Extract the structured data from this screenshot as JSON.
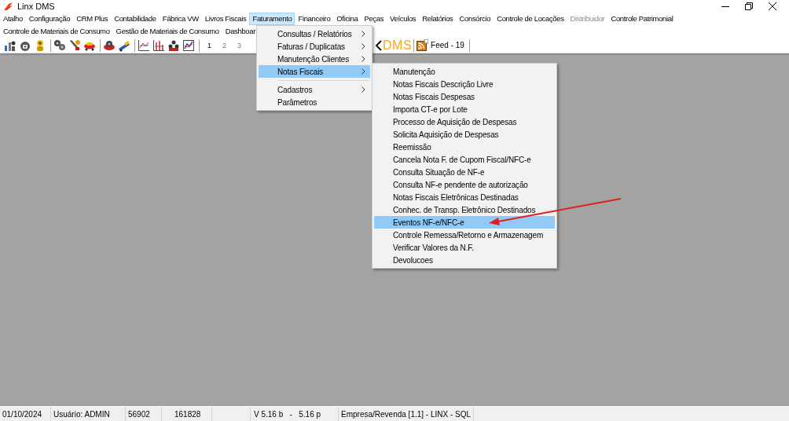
{
  "window": {
    "title": "Linx DMS"
  },
  "menu_bar": {
    "items": [
      {
        "label": "Atalho",
        "selected": false,
        "disabled": false
      },
      {
        "label": "Configuração",
        "selected": false,
        "disabled": false
      },
      {
        "label": "CRM Plus",
        "selected": false,
        "disabled": false
      },
      {
        "label": "Contabilidade",
        "selected": false,
        "disabled": false
      },
      {
        "label": "Fábrica VW",
        "selected": false,
        "disabled": false
      },
      {
        "label": "Livros Fiscais",
        "selected": false,
        "disabled": false
      },
      {
        "label": "Faturamento",
        "selected": true,
        "disabled": false
      },
      {
        "label": "Financeiro",
        "selected": false,
        "disabled": false
      },
      {
        "label": "Oficina",
        "selected": false,
        "disabled": false
      },
      {
        "label": "Peças",
        "selected": false,
        "disabled": false
      },
      {
        "label": "Veículos",
        "selected": false,
        "disabled": false
      },
      {
        "label": "Relatórios",
        "selected": false,
        "disabled": false
      },
      {
        "label": "Consórcio",
        "selected": false,
        "disabled": false
      },
      {
        "label": "Controle de Locações",
        "selected": false,
        "disabled": false
      },
      {
        "label": "Distribuidor",
        "selected": false,
        "disabled": true
      },
      {
        "label": "Controle Patrimonial",
        "selected": false,
        "disabled": false
      },
      {
        "label": "Controle de Materiais de Consumo",
        "selected": false,
        "disabled": false
      },
      {
        "label": "Gestão de Materiais de Consumo",
        "selected": false,
        "disabled": false
      },
      {
        "label": "Dashboar",
        "selected": false,
        "disabled": false
      }
    ]
  },
  "toolbar": {
    "page_buttons": [
      "1",
      "2",
      "3"
    ],
    "logo": "DMS",
    "feed": "Feed - 19"
  },
  "dropdown": {
    "items": [
      {
        "kind": "item",
        "label": "Consultas / Relatórios",
        "submenu": true,
        "selected": false
      },
      {
        "kind": "item",
        "label": "Faturas / Duplicatas",
        "submenu": true,
        "selected": false
      },
      {
        "kind": "item",
        "label": "Manutenção Clientes",
        "submenu": true,
        "selected": false
      },
      {
        "kind": "item",
        "label": "Notas Fiscais",
        "submenu": true,
        "selected": true
      },
      {
        "kind": "separator"
      },
      {
        "kind": "item",
        "label": "Cadastros",
        "submenu": true,
        "selected": false
      },
      {
        "kind": "item",
        "label": "Parâmetros",
        "submenu": false,
        "selected": false
      }
    ]
  },
  "submenu": {
    "items": [
      {
        "label": "Manutenção",
        "selected": false
      },
      {
        "label": "Notas Fiscais Descrição Livre",
        "selected": false
      },
      {
        "label": "Notas Fiscais Despesas",
        "selected": false
      },
      {
        "label": "Importa CT-e por Lote",
        "selected": false
      },
      {
        "label": "Processo de Aquisição de Despesas",
        "selected": false
      },
      {
        "label": "Solicita Aquisição de Despesas",
        "selected": false
      },
      {
        "label": "Reemissão",
        "selected": false
      },
      {
        "label": "Cancela Nota F. de Cupom Fiscal/NFC-e",
        "selected": false
      },
      {
        "label": "Consulta Situação de NF-e",
        "selected": false
      },
      {
        "label": "Consulta NF-e pendente de autorização",
        "selected": false
      },
      {
        "label": "Notas Fiscais Eletrônicas Destinadas",
        "selected": false
      },
      {
        "label": "Conhec. de Transp. Eletrônico Destinados",
        "selected": false
      },
      {
        "label": "Eventos NF-e/NFC-e",
        "selected": true
      },
      {
        "label": "Controle Remessa/Retorno e Armazenagem",
        "selected": false
      },
      {
        "label": "Verificar Valores da N.F.",
        "selected": false
      },
      {
        "label": "Devolucoes",
        "selected": false
      }
    ]
  },
  "status_bar": {
    "cells": [
      "01/10/2024",
      "Usuário: ADMIN",
      "56902",
      "161828",
      "V 5.16 b   -   5.16 p",
      "Empresa/Revenda [1.1] - LINX - SQL"
    ]
  }
}
